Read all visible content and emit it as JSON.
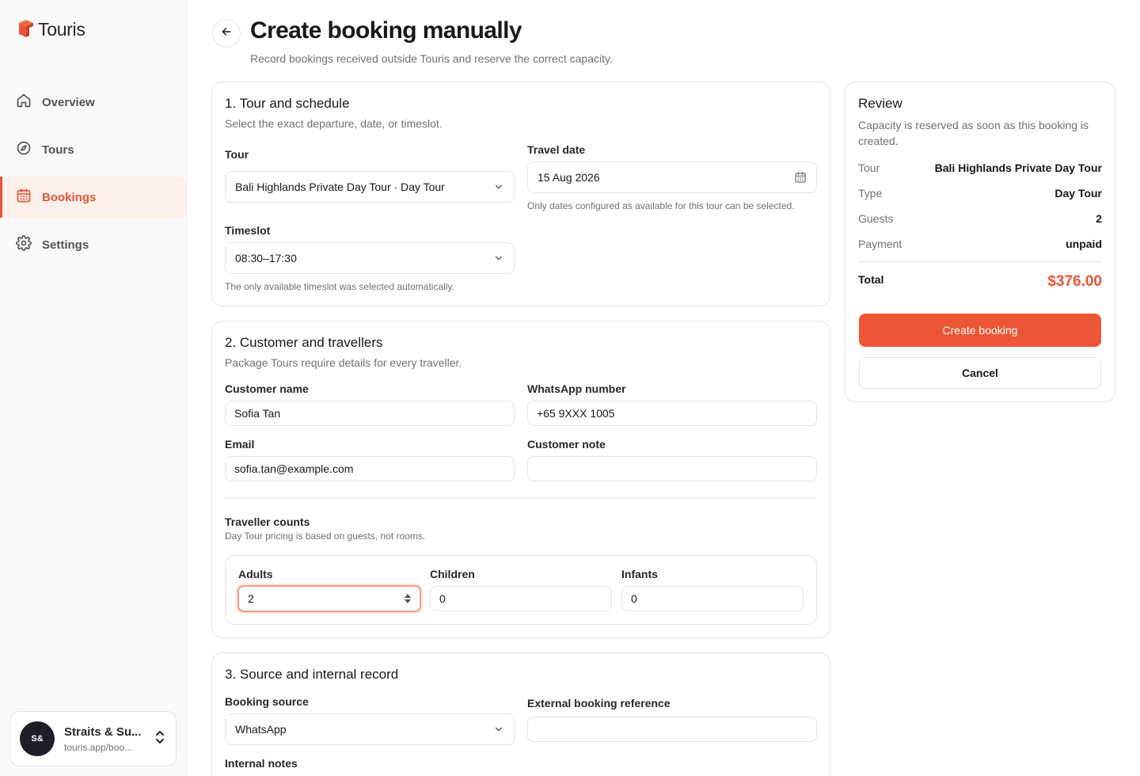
{
  "app": {
    "name": "Touris"
  },
  "sidebar": {
    "items": [
      {
        "label": "Overview",
        "icon": "home-icon"
      },
      {
        "label": "Tours",
        "icon": "compass-icon"
      },
      {
        "label": "Bookings",
        "icon": "calendar-icon",
        "active": true
      },
      {
        "label": "Settings",
        "icon": "gear-icon"
      }
    ],
    "account": {
      "initials": "S&",
      "name": "Straits & Su...",
      "url": "touris.app/boo..."
    }
  },
  "header": {
    "title": "Create booking manually",
    "subtitle": "Record bookings received outside Touris and reserve the correct capacity."
  },
  "section1": {
    "title": "1. Tour and schedule",
    "description": "Select the exact departure, date, or timeslot.",
    "tour_label": "Tour",
    "tour_value": "Bali Highlands Private Day Tour · Day Tour",
    "date_label": "Travel date",
    "date_value": "15 Aug 2026",
    "date_hint": "Only dates configured as available for this tour can be selected.",
    "timeslot_label": "Timeslot",
    "timeslot_value": "08:30–17:30",
    "timeslot_hint": "The only available timeslot was selected automatically."
  },
  "section2": {
    "title": "2. Customer and travellers",
    "description": "Package Tours require details for every traveller.",
    "name_label": "Customer name",
    "name_value": "Sofia Tan",
    "whatsapp_label": "WhatsApp number",
    "whatsapp_value": "+65 9XXX 1005",
    "email_label": "Email",
    "email_value": "sofia.tan@example.com",
    "note_label": "Customer note",
    "note_value": "",
    "counts_title": "Traveller counts",
    "counts_hint": "Day Tour pricing is based on guests, not rooms.",
    "adults_label": "Adults",
    "adults_value": "2",
    "children_label": "Children",
    "children_value": "0",
    "infants_label": "Infants",
    "infants_value": "0"
  },
  "section3": {
    "title": "3. Source and internal record",
    "source_label": "Booking source",
    "source_value": "WhatsApp",
    "reference_label": "External booking reference",
    "reference_value": "",
    "notes_label": "Internal notes"
  },
  "review": {
    "title": "Review",
    "description": "Capacity is reserved as soon as this booking is created.",
    "rows": [
      {
        "label": "Tour",
        "value": "Bali Highlands Private Day Tour"
      },
      {
        "label": "Type",
        "value": "Day Tour"
      },
      {
        "label": "Guests",
        "value": "2"
      },
      {
        "label": "Payment",
        "value": "unpaid"
      }
    ],
    "total_label": "Total",
    "total_value": "$376.00",
    "create_label": "Create booking",
    "cancel_label": "Cancel"
  },
  "colors": {
    "accent": "#ec5535",
    "active_bg": "#fdf0ea",
    "border": "#e4e4e7",
    "muted": "#71717a"
  }
}
